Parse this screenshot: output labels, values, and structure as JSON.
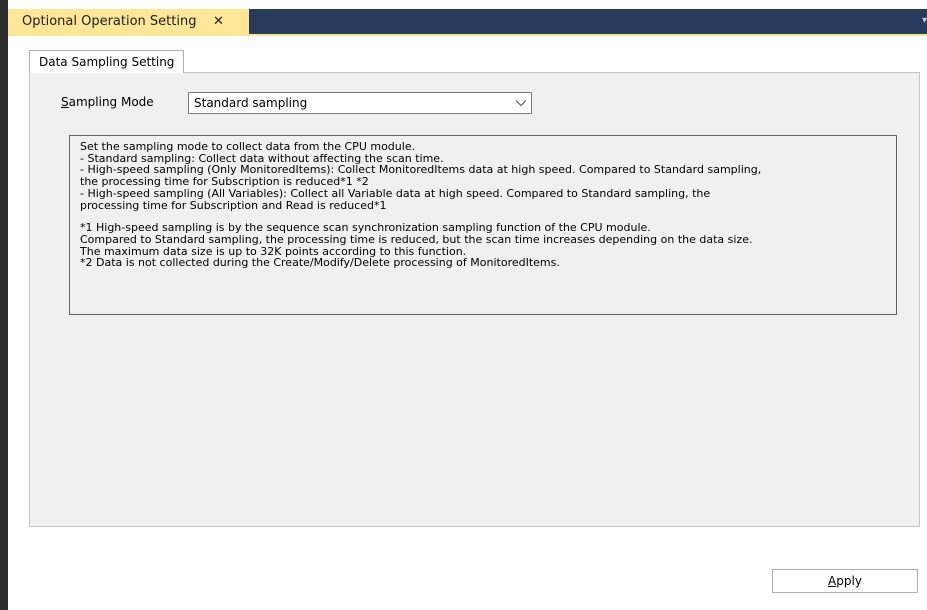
{
  "document_tab": {
    "title": "Optional Operation Setting",
    "close_glyph": "✕"
  },
  "tab_overflow_glyph": "▾",
  "settings_tab": {
    "label": "Data Sampling Setting"
  },
  "sampling_mode": {
    "label_mnemonic": "S",
    "label_rest": "ampling Mode",
    "selected_value": "Standard sampling"
  },
  "description": {
    "lines": [
      "Set the sampling mode to collect data from the CPU module.",
      "- Standard sampling: Collect data without affecting the scan time.",
      "- High-speed sampling (Only MonitoredItems): Collect MonitoredItems data at high speed. Compared to Standard sampling,",
      "the processing time for Subscription is reduced*1 *2",
      "- High-speed sampling (All Variables): Collect all Variable data at high speed. Compared to Standard sampling, the",
      "processing time for Subscription and Read is reduced*1",
      "",
      "*1 High-speed sampling is by the sequence scan synchronization sampling function of the CPU module.",
      "Compared to Standard sampling, the processing time is reduced, but the scan time increases depending on the data size.",
      "The maximum data size is up to 32K points according to this function.",
      "*2 Data is not collected during the Create/Modify/Delete processing of MonitoredItems."
    ]
  },
  "apply_button": {
    "label_mnemonic": "A",
    "label_rest": "pply"
  },
  "colors": {
    "active_tab": "#fde797",
    "tab_bar": "#283a5e",
    "panel_bg": "#f0f0f0"
  }
}
